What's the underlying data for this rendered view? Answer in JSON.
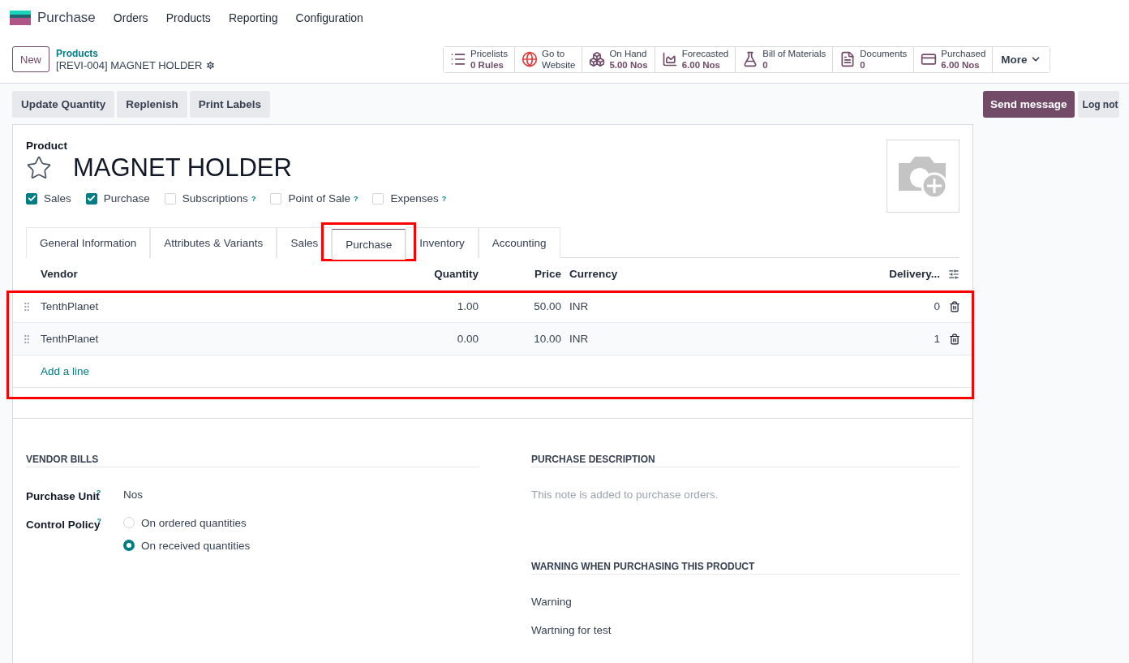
{
  "app": {
    "name": "Purchase",
    "menu": [
      "Orders",
      "Products",
      "Reporting",
      "Configuration"
    ]
  },
  "control_panel": {
    "new_button": "New",
    "breadcrumb": "Products",
    "record": "[REVI-004] MAGNET HOLDER",
    "stat_buttons": [
      {
        "kind": "list",
        "label": "Pricelists",
        "value": "0 Rules"
      },
      {
        "kind": "globe",
        "label": "Go to",
        "value": "Website"
      },
      {
        "kind": "boxes",
        "label": "On Hand",
        "value": "5.00 Nos"
      },
      {
        "kind": "area",
        "label": "Forecasted",
        "value": "6.00 Nos"
      },
      {
        "kind": "flask",
        "label": "Bill of Materials",
        "value": "0"
      },
      {
        "kind": "file",
        "label": "Documents",
        "value": "0"
      },
      {
        "kind": "card",
        "label": "Purchased",
        "value": "6.00 Nos"
      }
    ],
    "more": "More"
  },
  "actions": [
    "Update Quantity",
    "Replenish",
    "Print Labels"
  ],
  "chatter": {
    "send": "Send message",
    "log": "Log not"
  },
  "product": {
    "label": "Product",
    "name": "MAGNET HOLDER",
    "favorite": false,
    "flags": [
      {
        "label": "Sales",
        "checked": true
      },
      {
        "label": "Purchase",
        "checked": true
      },
      {
        "label": "Subscriptions",
        "checked": false,
        "help": "?"
      },
      {
        "label": "Point of Sale",
        "checked": false,
        "help": "?"
      },
      {
        "label": "Expenses",
        "checked": false,
        "help": "?"
      }
    ]
  },
  "tabs": [
    {
      "label": "General Information",
      "selected": false,
      "highlighted": false
    },
    {
      "label": "Attributes & Variants",
      "selected": false,
      "highlighted": false
    },
    {
      "label": "Sales",
      "selected": false,
      "highlighted": false
    },
    {
      "label": "Purchase",
      "selected": true,
      "highlighted": true
    },
    {
      "label": "Inventory",
      "selected": false,
      "highlighted": false
    },
    {
      "label": "Accounting",
      "selected": false,
      "highlighted": false
    }
  ],
  "vendor_table": {
    "highlighted": true,
    "columns": [
      "Vendor",
      "Quantity",
      "Price",
      "Currency",
      "Delivery..."
    ],
    "rows": [
      [
        "TenthPlanet",
        "1.00",
        "50.00",
        "INR",
        "0"
      ],
      [
        "TenthPlanet",
        "0.00",
        "10.00",
        "INR",
        "1"
      ]
    ],
    "add_line": "Add a line"
  },
  "vendor_bills": {
    "title": "VENDOR BILLS",
    "purchase_unit_label": "Purchase Unit",
    "purchase_unit_help": "?",
    "control_policy_help": "?",
    "purchase_unit": "Nos",
    "control_policy_label": "Control Policy",
    "options": [
      {
        "label": "On ordered quantities",
        "selected": false
      },
      {
        "label": "On received quantities",
        "selected": true
      }
    ]
  },
  "purchase_description": {
    "title": "PURCHASE DESCRIPTION",
    "placeholder": "This note is added to purchase orders."
  },
  "warning": {
    "title": "WARNING WHEN PURCHASING THIS PRODUCT",
    "value": "Warning",
    "message": "Wartning for test"
  }
}
